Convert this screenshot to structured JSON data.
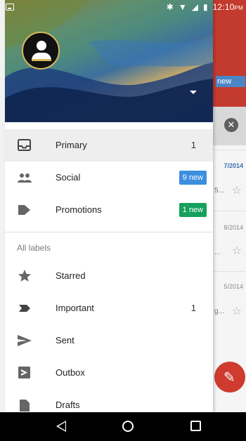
{
  "status_bar": {
    "time": "12:10",
    "ampm": "PM",
    "icons": [
      "notification-icon",
      "bluetooth-icon",
      "wifi-icon",
      "signal-icon",
      "battery-icon"
    ]
  },
  "drawer": {
    "avatar_icon": "person-icon",
    "account_dropdown_icon": "caret-down-icon",
    "items": [
      {
        "label": "Primary",
        "icon": "inbox-icon",
        "count": "1",
        "active": true
      },
      {
        "label": "Social",
        "icon": "people-icon",
        "badge": "9 new",
        "badge_color": "#3c8ee0"
      },
      {
        "label": "Promotions",
        "icon": "tag-icon",
        "badge": "1 new",
        "badge_color": "#16a05d"
      }
    ],
    "section_label": "All labels",
    "labels": [
      {
        "label": "Starred",
        "icon": "star-icon"
      },
      {
        "label": "Important",
        "icon": "important-icon",
        "count": "1"
      },
      {
        "label": "Sent",
        "icon": "send-icon"
      },
      {
        "label": "Outbox",
        "icon": "outbox-icon"
      },
      {
        "label": "Drafts",
        "icon": "draft-icon"
      }
    ]
  },
  "background_app": {
    "new_label": "new",
    "rows": [
      {
        "date": "7/2014",
        "snippet": "5...",
        "highlight": true
      },
      {
        "date": "8/2014",
        "snippet": "..."
      },
      {
        "date": "5/2014",
        "snippet": "g..."
      }
    ],
    "fab_icon": "pencil-icon"
  },
  "colors": {
    "accent": "#cf3b2e",
    "badge_blue": "#3c8ee0",
    "badge_green": "#16a05d"
  }
}
